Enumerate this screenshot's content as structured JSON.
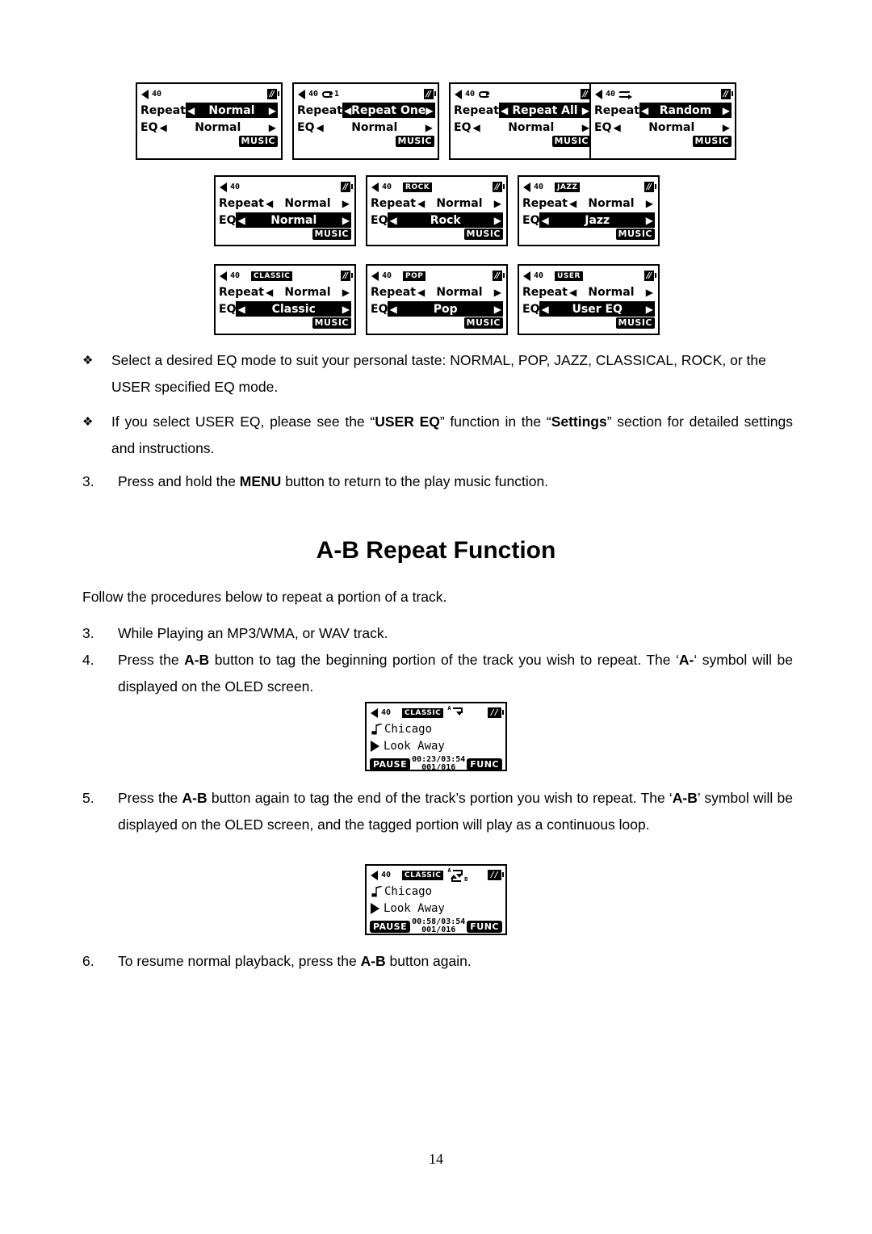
{
  "page": {
    "number": "14"
  },
  "lcd_screens_row1": [
    {
      "volume": "40",
      "mode_icon": "none",
      "eq_tag": "",
      "battery": "battery-icon",
      "repeat_label": "Repeat",
      "repeat_value": "Normal",
      "repeat_selected": true,
      "eq_label": "EQ",
      "eq_value": "Normal",
      "eq_selected": false,
      "badge": "MUSIC"
    },
    {
      "volume": "40",
      "mode_icon": "repeat-one-icon",
      "eq_tag": "",
      "battery": "battery-icon",
      "repeat_label": "Repeat",
      "repeat_value": "Repeat One",
      "repeat_selected": true,
      "eq_label": "EQ",
      "eq_value": "Normal",
      "eq_selected": false,
      "badge": "MUSIC"
    },
    {
      "volume": "40",
      "mode_icon": "repeat-all-icon",
      "eq_tag": "",
      "battery": "battery-icon",
      "repeat_label": "Repeat",
      "repeat_value": "Repeat All",
      "repeat_selected": true,
      "eq_label": "EQ",
      "eq_value": "Normal",
      "eq_selected": false,
      "badge": "MUSIC"
    },
    {
      "volume": "40",
      "mode_icon": "shuffle-icon",
      "eq_tag": "",
      "battery": "battery-icon",
      "repeat_label": "Repeat",
      "repeat_value": "Random",
      "repeat_selected": true,
      "eq_label": "EQ",
      "eq_value": "Normal",
      "eq_selected": false,
      "badge": "MUSIC"
    }
  ],
  "lcd_screens_row2": [
    {
      "volume": "40",
      "eq_tag": "",
      "repeat_label": "Repeat",
      "repeat_value": "Normal",
      "eq_label": "EQ",
      "eq_value": "Normal",
      "badge": "MUSIC"
    },
    {
      "volume": "40",
      "eq_tag": "ROCK",
      "repeat_label": "Repeat",
      "repeat_value": "Normal",
      "eq_label": "EQ",
      "eq_value": "Rock",
      "badge": "MUSIC"
    },
    {
      "volume": "40",
      "eq_tag": "JAZZ",
      "repeat_label": "Repeat",
      "repeat_value": "Normal",
      "eq_label": "EQ",
      "eq_value": "Jazz",
      "badge": "MUSIC"
    }
  ],
  "lcd_screens_row3": [
    {
      "volume": "40",
      "eq_tag": "CLASSIC",
      "repeat_label": "Repeat",
      "repeat_value": "Normal",
      "eq_label": "EQ",
      "eq_value": "Classic",
      "badge": "MUSIC"
    },
    {
      "volume": "40",
      "eq_tag": "POP",
      "repeat_label": "Repeat",
      "repeat_value": "Normal",
      "eq_label": "EQ",
      "eq_value": "Pop",
      "badge": "MUSIC"
    },
    {
      "volume": "40",
      "eq_tag": "USER",
      "repeat_label": "Repeat",
      "repeat_value": "Normal",
      "eq_label": "EQ",
      "eq_value": "User EQ",
      "badge": "MUSIC"
    }
  ],
  "bullets": [
    {
      "mark": "❖",
      "text": "Select a desired EQ mode to suit your personal taste: NORMAL, POP, JAZZ, CLASSICAL, ROCK, or the USER specified EQ mode."
    }
  ],
  "bullet2": {
    "mark": "❖",
    "part1": "If you select USER EQ, please see the “",
    "bold1": "USER EQ",
    "part2": "” function in the “",
    "bold2": "Settings",
    "part3": "” section for detailed settings and instructions."
  },
  "step3_eq": {
    "mark": "3.",
    "part1": "Press and hold the ",
    "bold1": "MENU",
    "part2": " button to return to the play music function."
  },
  "section_heading": "A-B Repeat Function",
  "intro_text": "Follow the procedures below to repeat a portion of a track.",
  "step3": {
    "mark": "3.",
    "text": "While Playing an MP3/WMA, or WAV track."
  },
  "step4": {
    "mark": "4.",
    "part1": "Press the ",
    "bold1": "A-B",
    "part2": " button to tag the beginning portion of the track you wish to repeat. The ‘",
    "bold2": "A-",
    "part3": "‘ symbol will be displayed on the OLED screen."
  },
  "step5": {
    "mark": "5.",
    "part1": "Press the ",
    "bold1": "A-B",
    "part2": " button again to tag the end of the track’s portion you wish to repeat. The ‘",
    "bold2": "A-B",
    "part3": "’ symbol will be displayed on the OLED screen, and the tagged portion will play as a continuous loop."
  },
  "step6": {
    "mark": "6.",
    "part1": "To resume normal playback, press the ",
    "bold1": "A-B",
    "part2": " button again."
  },
  "player_screen_a": {
    "volume": "40",
    "eq_tag": "CLASSIC",
    "ab_marker": "A-",
    "ab_letter_a": "A",
    "ab_letter_b": "",
    "battery": "battery-icon",
    "artist": "Chicago",
    "title": "Look Away",
    "status_button": "PAUSE",
    "time": "00:23/03:54",
    "track": "001/016",
    "func_button": "FUNC"
  },
  "player_screen_ab": {
    "volume": "40",
    "eq_tag": "CLASSIC",
    "ab_marker": "A-B",
    "ab_letter_a": "A",
    "ab_letter_b": "B",
    "battery": "battery-icon",
    "artist": "Chicago",
    "title": "Look Away",
    "status_button": "PAUSE",
    "time": "00:58/03:54",
    "track": "001/016",
    "func_button": "FUNC"
  }
}
